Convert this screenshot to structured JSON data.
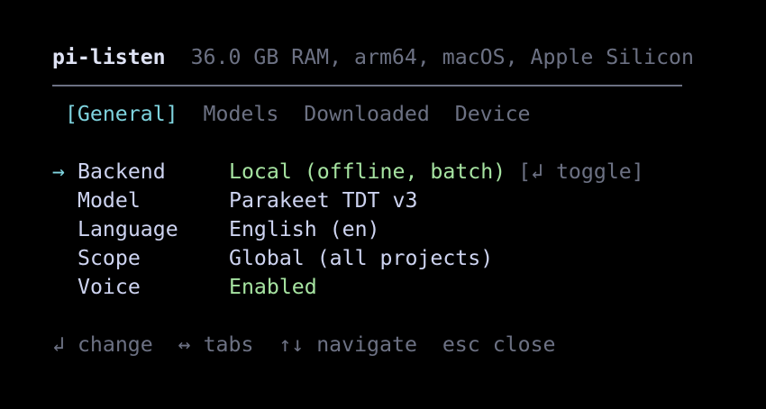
{
  "header": {
    "title": "pi-listen",
    "system_info": "36.0 GB RAM, arm64, macOS, Apple Silicon"
  },
  "tabs": [
    {
      "label": "[General]",
      "active": true
    },
    {
      "label": "Models",
      "active": false
    },
    {
      "label": "Downloaded",
      "active": false
    },
    {
      "label": "Device",
      "active": false
    }
  ],
  "settings": [
    {
      "label": "Backend",
      "value": "Local (offline, batch)",
      "hint": "[↲ toggle]",
      "selected": true,
      "value_color": "green"
    },
    {
      "label": "Model",
      "value": "Parakeet TDT v3"
    },
    {
      "label": "Language",
      "value": "English (en)"
    },
    {
      "label": "Scope",
      "value": "Global (all projects)"
    },
    {
      "label": "Voice",
      "value": "Enabled",
      "value_color": "green"
    }
  ],
  "cursor": "→",
  "footer": [
    {
      "key": "↲",
      "action": "change"
    },
    {
      "key": "↔",
      "action": "tabs"
    },
    {
      "key": "↑↓",
      "action": "navigate"
    },
    {
      "key": "esc",
      "action": "close"
    }
  ],
  "colors": {
    "accent": "#7fd4df",
    "green": "#a6e3a1",
    "dim": "#6c7183",
    "text": "#cdd3f0"
  }
}
